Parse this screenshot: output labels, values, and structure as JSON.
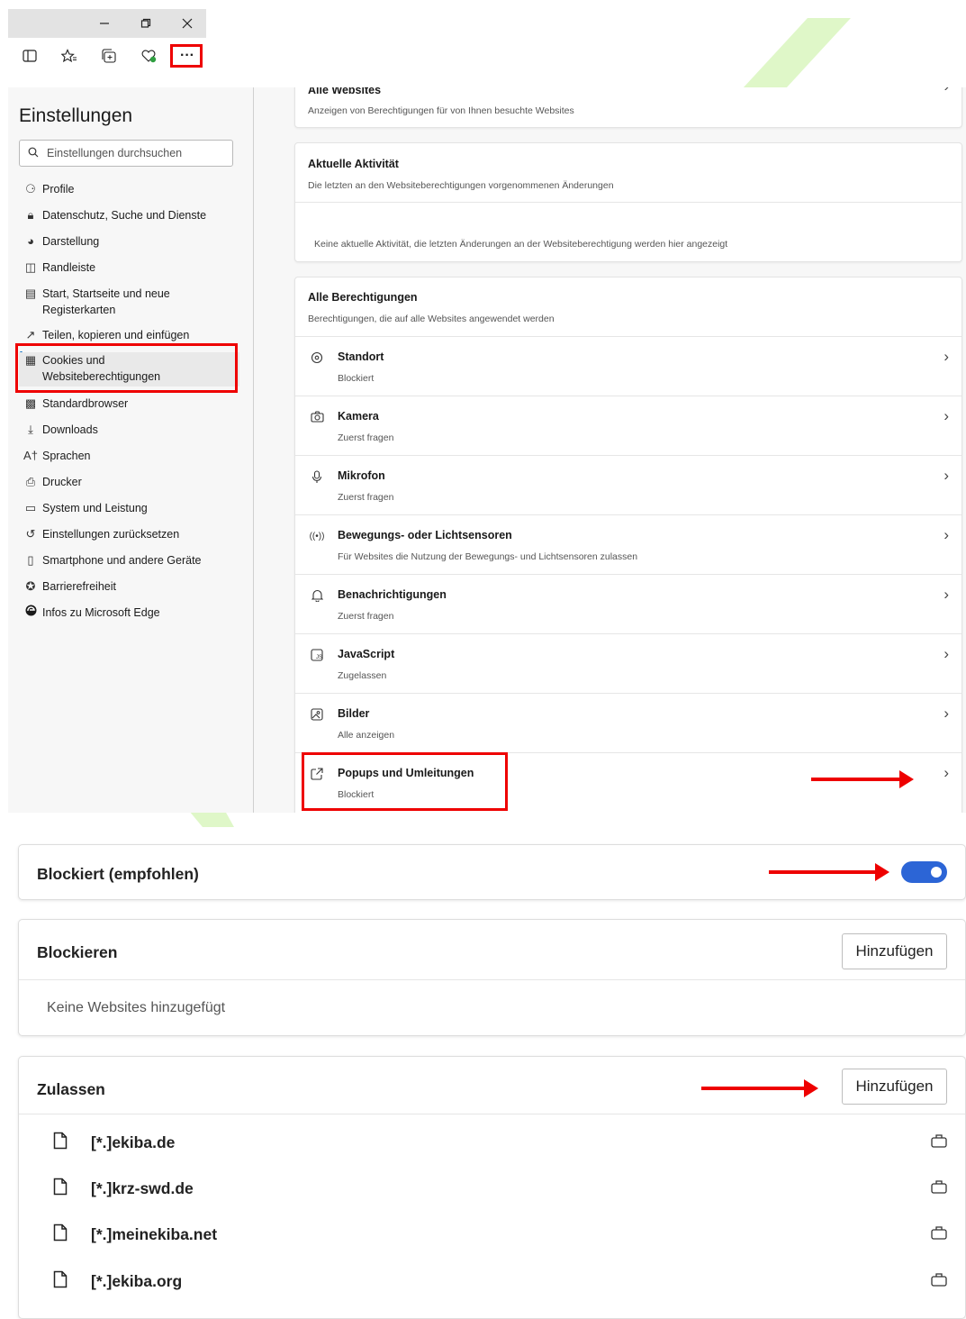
{
  "window": {
    "minimize_icon": "minimize-icon",
    "restore_icon": "restore-icon",
    "close_icon": "close-icon",
    "toolbar_icons": [
      "split-screen-icon",
      "favorites-icon",
      "collections-icon",
      "browser-essentials-icon",
      "more-icon"
    ],
    "more_label": "···"
  },
  "sidebar": {
    "title": "Einstellungen",
    "search_placeholder": "Einstellungen durchsuchen",
    "items": [
      {
        "label": "Profile"
      },
      {
        "label": "Datenschutz, Suche und Dienste"
      },
      {
        "label": "Darstellung"
      },
      {
        "label": "Randleiste"
      },
      {
        "label": "Start, Startseite und neue Registerkarten"
      },
      {
        "label": "Teilen, kopieren und einfügen"
      },
      {
        "label": "Cookies und Websiteberechtigungen"
      },
      {
        "label": "Standardbrowser"
      },
      {
        "label": "Downloads"
      },
      {
        "label": "Sprachen"
      },
      {
        "label": "Drucker"
      },
      {
        "label": "System und Leistung"
      },
      {
        "label": "Einstellungen zurücksetzen"
      },
      {
        "label": "Smartphone und andere Geräte"
      },
      {
        "label": "Barrierefreiheit"
      },
      {
        "label": "Infos zu Microsoft Edge"
      }
    ]
  },
  "main": {
    "all_websites": {
      "title": "Alle Websites",
      "sub": "Anzeigen von Berechtigungen für von Ihnen besuchte Websites"
    },
    "recent": {
      "title": "Aktuelle Aktivität",
      "sub": "Die letzten an den Websiteberechtigungen vorgenommenen Änderungen",
      "empty": "Keine aktuelle Aktivität, die letzten Änderungen an der Websiteberechtigung werden hier angezeigt"
    },
    "all_permissions": {
      "title": "Alle Berechtigungen",
      "sub": "Berechtigungen, die auf alle Websites angewendet werden"
    },
    "permissions": [
      {
        "title": "Standort",
        "sub": "Blockiert",
        "icon": "location-icon"
      },
      {
        "title": "Kamera",
        "sub": "Zuerst fragen",
        "icon": "camera-icon"
      },
      {
        "title": "Mikrofon",
        "sub": "Zuerst fragen",
        "icon": "microphone-icon"
      },
      {
        "title": "Bewegungs- oder Lichtsensoren",
        "sub": "Für Websites die Nutzung der Bewegungs- und Lichtsensoren zulassen",
        "icon": "sensor-icon"
      },
      {
        "title": "Benachrichtigungen",
        "sub": "Zuerst fragen",
        "icon": "bell-icon"
      },
      {
        "title": "JavaScript",
        "sub": "Zugelassen",
        "icon": "javascript-icon"
      },
      {
        "title": "Bilder",
        "sub": "Alle anzeigen",
        "icon": "image-icon"
      },
      {
        "title": "Popups und Umleitungen",
        "sub": "Blockiert",
        "icon": "popup-icon"
      }
    ]
  },
  "popups": {
    "blocked_label": "Blockiert (empfohlen)",
    "block_section": {
      "title": "Blockieren",
      "button": "Hinzufügen",
      "empty": "Keine Websites hinzugefügt"
    },
    "allow_section": {
      "title": "Zulassen",
      "button": "Hinzufügen"
    },
    "allowed_sites": [
      "[*.]ekiba.de",
      "[*.]krz-swd.de",
      "[*.]meinekiba.net",
      "[*.]ekiba.org"
    ]
  },
  "colors": {
    "accent": "#2c65d6",
    "highlight": "#ee0000",
    "active_bar": "#0067c0"
  }
}
